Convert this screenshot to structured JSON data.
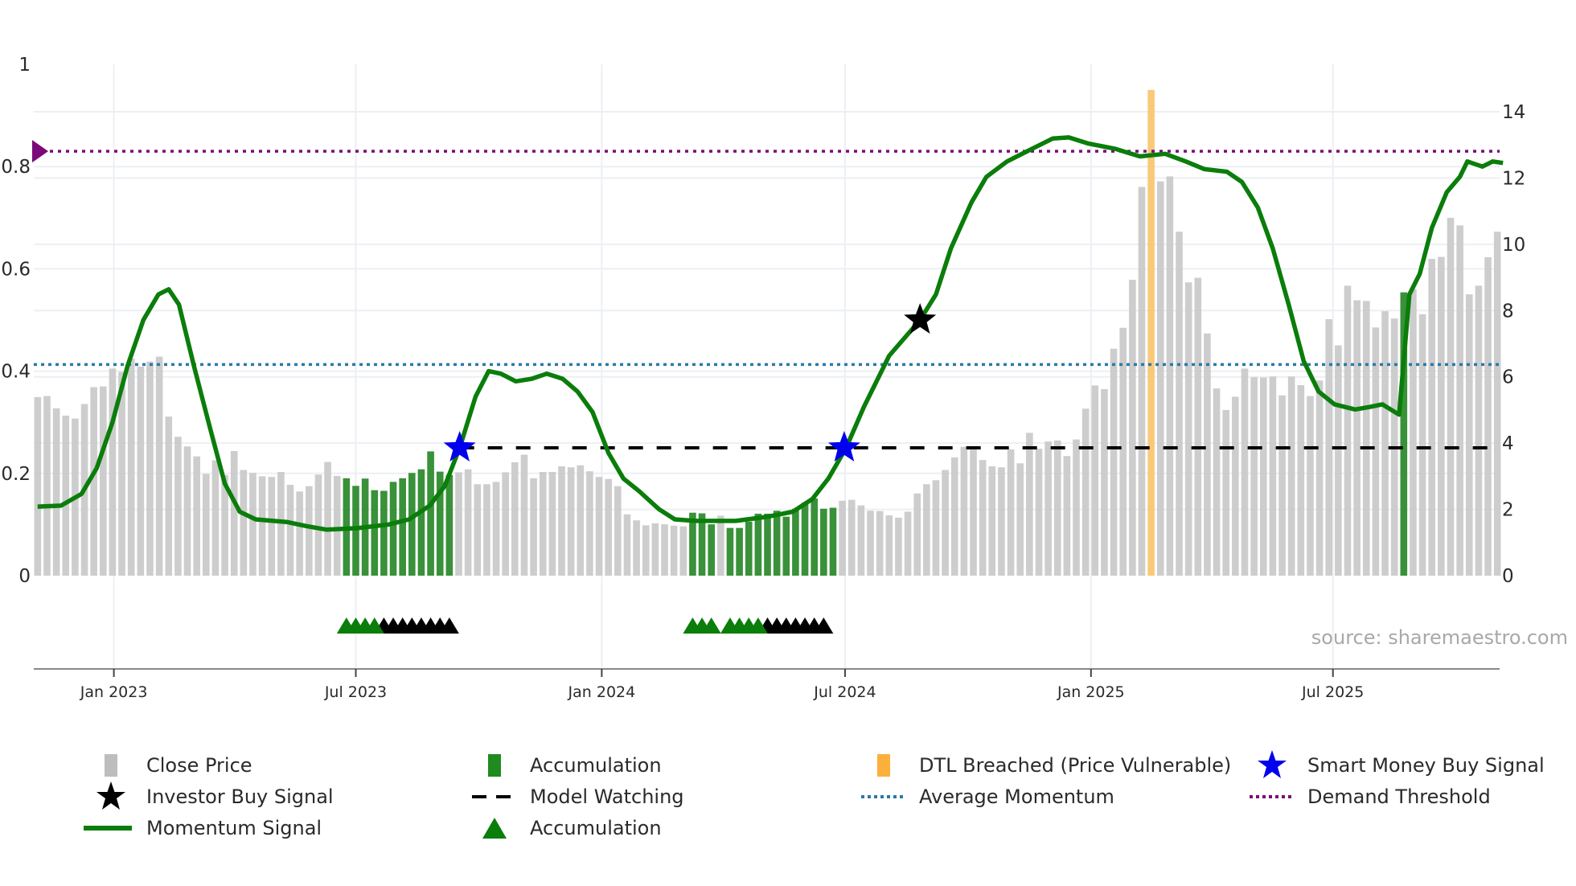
{
  "chart_data": {
    "type": "bar",
    "title": "",
    "start_date": "2022-11-05",
    "interval_days": 7,
    "x_ticks": [
      {
        "label": "Jan 2023",
        "date": "2023-01-01"
      },
      {
        "label": "Jul 2023",
        "date": "2023-07-01"
      },
      {
        "label": "Jan 2024",
        "date": "2024-01-01"
      },
      {
        "label": "Jul 2024",
        "date": "2024-07-01"
      },
      {
        "label": "Jan 2025",
        "date": "2025-01-01"
      },
      {
        "label": "Jul 2025",
        "date": "2025-07-01"
      }
    ],
    "x_range": [
      "2022-11-02",
      "2025-11-02"
    ],
    "left_axis": {
      "label": "",
      "range": [
        0,
        1
      ],
      "ticks": [
        "0",
        "0.2",
        "0.4",
        "0.6",
        "0.8",
        "1"
      ]
    },
    "right_axis": {
      "label": "",
      "range": [
        0,
        14
      ],
      "ticks": [
        "0",
        "2",
        "4",
        "6",
        "8",
        "10",
        "12",
        "14"
      ]
    },
    "close_price": [
      5.39,
      5.42,
      5.05,
      4.83,
      4.74,
      5.18,
      5.69,
      5.71,
      6.25,
      6.15,
      6.55,
      6.31,
      6.46,
      6.61,
      4.8,
      4.19,
      3.9,
      3.6,
      3.07,
      3.48,
      3.04,
      3.76,
      3.19,
      3.1,
      3.0,
      2.98,
      3.13,
      2.74,
      2.54,
      2.7,
      3.05,
      3.43,
      3.01,
      2.94,
      2.71,
      2.93,
      2.58,
      2.56,
      2.83,
      2.94,
      3.1,
      3.21,
      3.75,
      3.14,
      3.04,
      3.12,
      3.21,
      2.76,
      2.76,
      2.83,
      3.12,
      3.42,
      3.65,
      2.94,
      3.13,
      3.13,
      3.3,
      3.27,
      3.33,
      3.15,
      2.98,
      2.92,
      2.7,
      1.85,
      1.67,
      1.52,
      1.58,
      1.55,
      1.51,
      1.49,
      1.9,
      1.88,
      1.55,
      1.81,
      1.44,
      1.44,
      1.63,
      1.87,
      1.87,
      1.96,
      1.78,
      2.02,
      2.2,
      2.33,
      2.02,
      2.05,
      2.26,
      2.29,
      2.12,
      1.96,
      1.95,
      1.82,
      1.75,
      1.93,
      2.48,
      2.76,
      2.88,
      3.19,
      3.57,
      3.89,
      3.87,
      3.49,
      3.3,
      3.27,
      3.81,
      3.39,
      4.31,
      3.83,
      4.05,
      4.08,
      3.61,
      4.11,
      5.04,
      5.74,
      5.63,
      6.85,
      7.48,
      8.93,
      11.73,
      null,
      11.9,
      12.05,
      10.38,
      8.85,
      8.99,
      7.31,
      5.65,
      5.0,
      5.4,
      6.25,
      5.99,
      5.98,
      6.01,
      5.44,
      6.01,
      5.75,
      5.42,
      5.89,
      7.74,
      6.95,
      8.75,
      8.31,
      8.29,
      7.49,
      7.98,
      7.76,
      8.55,
      8.65,
      7.89,
      9.56,
      9.62,
      10.8,
      10.57,
      8.49,
      8.75,
      9.61,
      10.38
    ],
    "accumulation_weeks": [
      33,
      34,
      35,
      36,
      37,
      38,
      39,
      40,
      41,
      42,
      43,
      44,
      70,
      71,
      72,
      74,
      75,
      76,
      77,
      78,
      79,
      80,
      81,
      82,
      83,
      84,
      85,
      146
    ],
    "dtl_breach": {
      "week": 119,
      "level": 14.66
    },
    "momentum": [
      [
        0,
        0.135
      ],
      [
        2.5,
        0.137
      ],
      [
        4.7,
        0.16
      ],
      [
        6.3,
        0.21
      ],
      [
        8,
        0.3
      ],
      [
        9.6,
        0.41
      ],
      [
        11.3,
        0.5
      ],
      [
        12.9,
        0.55
      ],
      [
        14,
        0.56
      ],
      [
        15.1,
        0.53
      ],
      [
        16.7,
        0.41
      ],
      [
        18.4,
        0.29
      ],
      [
        20,
        0.18
      ],
      [
        21.6,
        0.125
      ],
      [
        23.3,
        0.11
      ],
      [
        26.6,
        0.105
      ],
      [
        28.7,
        0.097
      ],
      [
        30.9,
        0.09
      ],
      [
        34.2,
        0.093
      ],
      [
        37.5,
        0.1
      ],
      [
        39.7,
        0.11
      ],
      [
        41.9,
        0.137
      ],
      [
        43.5,
        0.175
      ],
      [
        45.1,
        0.25
      ],
      [
        46.8,
        0.35
      ],
      [
        48.2,
        0.4
      ],
      [
        49.5,
        0.395
      ],
      [
        51.1,
        0.38
      ],
      [
        52.8,
        0.385
      ],
      [
        54.4,
        0.395
      ],
      [
        56.1,
        0.385
      ],
      [
        57.7,
        0.36
      ],
      [
        59.3,
        0.32
      ],
      [
        61,
        0.24
      ],
      [
        62.6,
        0.19
      ],
      [
        64.3,
        0.165
      ],
      [
        66.4,
        0.13
      ],
      [
        68.1,
        0.11
      ],
      [
        70.3,
        0.107
      ],
      [
        74.6,
        0.107
      ],
      [
        77.9,
        0.115
      ],
      [
        80.7,
        0.125
      ],
      [
        82.8,
        0.15
      ],
      [
        84.5,
        0.19
      ],
      [
        86.4,
        0.25
      ],
      [
        88.3,
        0.33
      ],
      [
        91,
        0.43
      ],
      [
        94.3,
        0.5
      ],
      [
        96,
        0.55
      ],
      [
        97.6,
        0.64
      ],
      [
        99.8,
        0.73
      ],
      [
        101.4,
        0.78
      ],
      [
        103.6,
        0.81
      ],
      [
        106.3,
        0.835
      ],
      [
        108.5,
        0.855
      ],
      [
        110.2,
        0.857
      ],
      [
        112.3,
        0.845
      ],
      [
        115.1,
        0.835
      ],
      [
        117.8,
        0.82
      ],
      [
        120.5,
        0.825
      ],
      [
        122.7,
        0.81
      ],
      [
        124.7,
        0.795
      ],
      [
        127.1,
        0.79
      ],
      [
        128.7,
        0.77
      ],
      [
        130.4,
        0.72
      ],
      [
        132,
        0.64
      ],
      [
        133.7,
        0.53
      ],
      [
        135.3,
        0.42
      ],
      [
        136.9,
        0.36
      ],
      [
        138.6,
        0.335
      ],
      [
        140.8,
        0.325
      ],
      [
        142.4,
        0.33
      ],
      [
        143.7,
        0.335
      ],
      [
        145.5,
        0.315
      ],
      [
        146.6,
        0.55
      ],
      [
        147.7,
        0.59
      ],
      [
        149,
        0.68
      ],
      [
        150.6,
        0.75
      ],
      [
        152,
        0.78
      ],
      [
        152.8,
        0.81
      ],
      [
        154.4,
        0.8
      ],
      [
        155.5,
        0.81
      ],
      [
        156.6,
        0.807
      ]
    ],
    "demand_threshold": 0.83,
    "average_momentum": 0.413,
    "model_watching": {
      "from_week": 45.1,
      "level": 0.25
    },
    "smart_money_buy": [
      [
        45.1,
        0.25
      ],
      [
        86.2,
        0.25
      ]
    ],
    "investor_buy": [
      [
        94.3,
        0.5
      ]
    ],
    "accumulation_triangles": [
      33,
      34,
      35,
      36,
      70,
      71,
      72,
      74,
      75,
      76,
      77
    ],
    "watch_triangles": [
      37,
      38,
      39,
      40,
      41,
      42,
      43,
      44,
      78,
      79,
      80,
      81,
      82,
      83,
      84
    ],
    "source": "source: sharemaestro.com",
    "legend": [
      {
        "label": "Close Price",
        "icon": "gray-bar"
      },
      {
        "label": "Accumulation",
        "icon": "green-bar"
      },
      {
        "label": "DTL Breached (Price Vulnerable)",
        "icon": "orange-bar"
      },
      {
        "label": "Smart Money Buy Signal",
        "icon": "blue-star"
      },
      {
        "label": "Investor Buy Signal",
        "icon": "black-star"
      },
      {
        "label": "Model Watching",
        "icon": "black-dash"
      },
      {
        "label": "Average Momentum",
        "icon": "blue-dot-line"
      },
      {
        "label": "Demand Threshold",
        "icon": "purple-dot-line"
      },
      {
        "label": "Momentum Signal",
        "icon": "green-line"
      },
      {
        "label": "Accumulation",
        "icon": "green-triangle"
      }
    ],
    "colors": {
      "close": "#c8c8c8",
      "accum": "#2e8b2e",
      "dtl": "#f9c97a",
      "momentum": "#0a7d0a",
      "demand": "#7a0a7a",
      "avg": "#2b79a8",
      "watch": "#000000",
      "smart": "#0000ee",
      "grid": "#eceff3",
      "axis": "#888888",
      "tri_green": "#0a7d0a"
    }
  }
}
